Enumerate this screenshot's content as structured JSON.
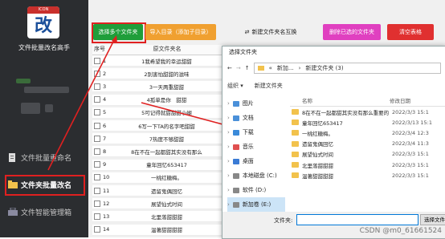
{
  "sidebar": {
    "logo_band": "ICON",
    "logo_glyph": "改",
    "app_name": "文件批量改名高手",
    "items": [
      {
        "label": "文件批量重命名"
      },
      {
        "label": "文件夹批量改名"
      },
      {
        "label": "文件智能管理箱"
      }
    ]
  },
  "toolbar": {
    "select_folders": "选择多个文件夹",
    "import_dirs": "导入目录（添加子目录）",
    "new_folder_swap": "新建文件夹名互换",
    "delete_selected": "删除已选的文件夹",
    "clear_list": "清空表格"
  },
  "grid": {
    "col_num": "序号",
    "col_name": "原文件夹名",
    "rows": [
      {
        "num": "1",
        "name": "1我希望我的幸运甜甜"
      },
      {
        "num": "2",
        "name": "2别害怕甜甜的滋味"
      },
      {
        "num": "3",
        "name": "3一天两重甜甜"
      },
      {
        "num": "4",
        "name": "4孤单是你　甜甜"
      },
      {
        "num": "5",
        "name": "5可记得就甜甜甜小蝴"
      },
      {
        "num": "6",
        "name": "6写一下TA的名字吧甜甜"
      },
      {
        "num": "7",
        "name": "7热度不够甜甜"
      },
      {
        "num": "8",
        "name": "8在不在一起都甜其实没有那么"
      },
      {
        "num": "9",
        "name": "童年回忆653417"
      },
      {
        "num": "10",
        "name": "一桃红糖梅。"
      },
      {
        "num": "11",
        "name": "遗留鬼偶回忆"
      },
      {
        "num": "12",
        "name": "展望仙式时间"
      },
      {
        "num": "13",
        "name": "北里落甜甜甜"
      },
      {
        "num": "14",
        "name": "温著甜甜甜甜"
      }
    ]
  },
  "dialog": {
    "title": "选择文件夹",
    "path": [
      "«",
      "新加...",
      "新建文件夹 (3)"
    ],
    "organize": "组织 ▾",
    "new_folder": "新建文件夹",
    "tree": [
      {
        "label": "图片"
      },
      {
        "label": "文档"
      },
      {
        "label": "下载"
      },
      {
        "label": "音乐"
      },
      {
        "label": "桌面"
      },
      {
        "label": "本地磁盘 (C:)"
      },
      {
        "label": "软件 (D:)"
      },
      {
        "label": "新加卷 (E:)"
      }
    ],
    "list_col_name": "名称",
    "list_col_date": "修改日期",
    "files": [
      {
        "name": "8在不在一起都甜其实没有那么重要的",
        "date": "2022/3/3 15:1"
      },
      {
        "name": "童年回忆653417",
        "date": "2022/3/13 15:1"
      },
      {
        "name": "一桃红糖梅。",
        "date": "2022/3/4 12:3"
      },
      {
        "name": "遗留鬼偶回忆",
        "date": "2022/3/4 11:3"
      },
      {
        "name": "展望仙式时间",
        "date": "2022/3/3 15:1"
      },
      {
        "name": "北里落甜甜甜",
        "date": "2022/3/3 15:1"
      },
      {
        "name": "温著甜甜甜甜",
        "date": "2022/3/3 15:1"
      }
    ],
    "folder_label": "文件夹:",
    "select_button": "选择文件"
  },
  "watermark": "CSDN @m0_61661524",
  "colors": {
    "sidebar_bg": "#2b2d30",
    "green_btn": "#1f9e3a",
    "orange_btn": "#f0a030",
    "magenta_btn": "#e040c0",
    "red_btn": "#e03030",
    "highlight": "#e02020"
  }
}
